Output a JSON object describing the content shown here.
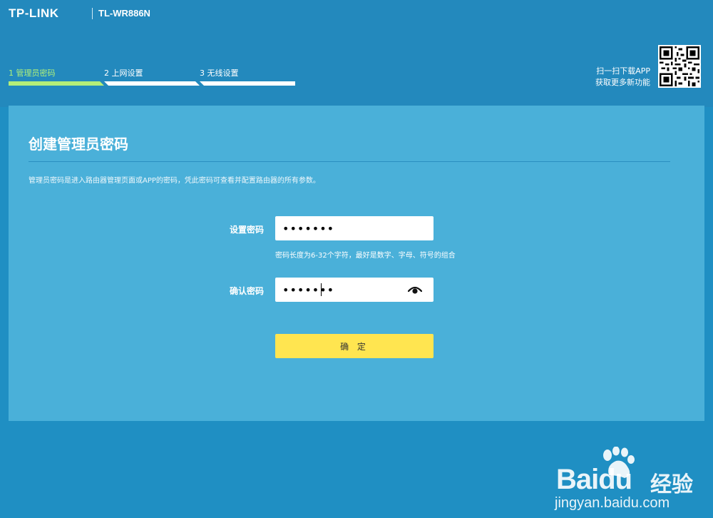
{
  "header": {
    "brand": "TP-LINK",
    "model": "TL-WR886N"
  },
  "steps": [
    {
      "label": "1 管理员密码",
      "active": true
    },
    {
      "label": "2 上网设置",
      "active": false
    },
    {
      "label": "3 无线设置",
      "active": false
    }
  ],
  "app_promo": {
    "line1": "扫一扫下载APP",
    "line2": "获取更多新功能"
  },
  "panel": {
    "title": "创建管理员密码",
    "description": "管理员密码是进入路由器管理页面或APP的密码，凭此密码可查看并配置路由器的所有参数。"
  },
  "form": {
    "password_label": "设置密码",
    "password_value": "•••••••",
    "password_hint": "密码长度为6-32个字符，最好是数字、字母、符号的组合",
    "confirm_label": "确认密码",
    "confirm_value": "•••••••",
    "submit_label": "确 定"
  },
  "watermark": {
    "brand": "Baidu",
    "brand_cn": "经验",
    "url": "jingyan.baidu.com"
  },
  "colors": {
    "header_bg": "#2389bd",
    "panel_bg": "#4ab0d9",
    "active_step": "#b4ee78",
    "button": "#ffe550"
  }
}
